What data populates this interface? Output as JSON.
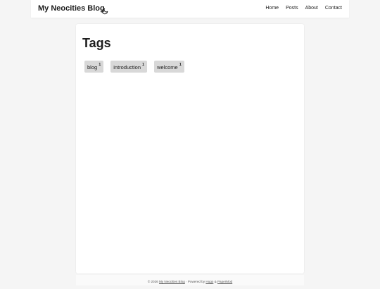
{
  "header": {
    "site_title": "My Neocities Blog",
    "theme_toggle_icon": "moon-icon",
    "nav": [
      {
        "label": "Home"
      },
      {
        "label": "Posts"
      },
      {
        "label": "About"
      },
      {
        "label": "Contact"
      }
    ]
  },
  "main": {
    "title": "Tags",
    "tags": [
      {
        "label": "blog",
        "count": "1"
      },
      {
        "label": "introduction",
        "count": "1"
      },
      {
        "label": "welcome",
        "count": "1"
      }
    ]
  },
  "footer": {
    "copyright": "© 2026",
    "site_link": "My Neocities Blog",
    "separator": " · Powered by ",
    "hugo_link": "Hugo",
    "amp": " & ",
    "theme_link": "PaperMod"
  }
}
